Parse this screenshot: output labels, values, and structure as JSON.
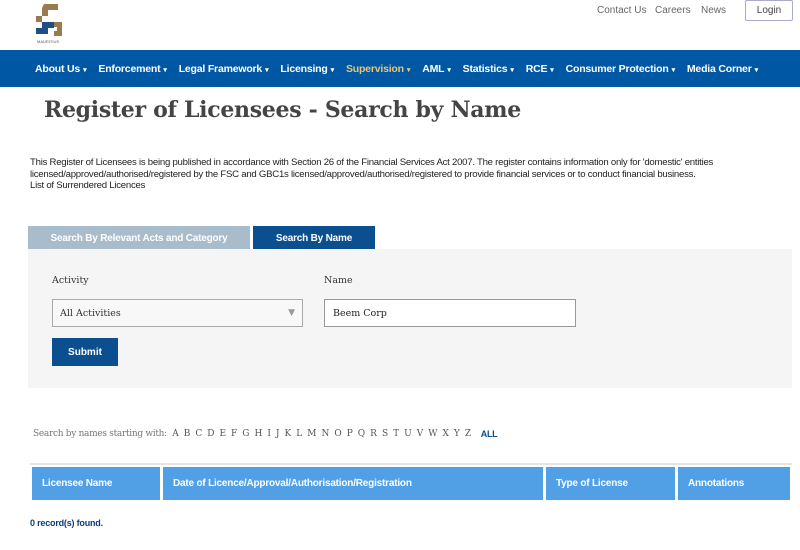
{
  "header": {
    "logo_text": "MAURITIUS",
    "links": [
      "Contact Us",
      "Careers",
      "News"
    ],
    "login_label": "Login"
  },
  "nav": {
    "items": [
      "About Us",
      "Enforcement",
      "Legal Framework",
      "Licensing",
      "Supervision",
      "AML",
      "Statistics",
      "RCE",
      "Consumer Protection",
      "Media Corner"
    ],
    "active": "Supervision",
    "caret": "▾"
  },
  "page": {
    "title": "Register of Licensees - Search by Name",
    "intro": "This Register of Licensees is being published in accordance with Section 26 of the Financial Services Act 2007. The register contains information only for 'domestic' entities licensed/approved/authorised/registered by the FSC and GBC1s licensed/approved/authorised/registered to provide financial services or to conduct financial business.",
    "surrendered_link": "List of Surrendered Licences"
  },
  "tabs": [
    {
      "label": "Search By Relevant Acts and Category",
      "active": false
    },
    {
      "label": "Search By Name",
      "active": true
    }
  ],
  "form": {
    "activity_label": "Activity",
    "activity_value": "All Activities",
    "name_label": "Name",
    "name_value": "Beem Corp",
    "submit_label": "Submit"
  },
  "alpha": {
    "label": "Search by names starting with:",
    "letters": [
      "A",
      "B",
      "C",
      "D",
      "E",
      "F",
      "G",
      "H",
      "I",
      "J",
      "K",
      "L",
      "M",
      "N",
      "O",
      "P",
      "Q",
      "R",
      "S",
      "T",
      "U",
      "V",
      "W",
      "X",
      "Y",
      "Z"
    ],
    "all_label": "ALL"
  },
  "table": {
    "columns": [
      "Licensee Name",
      "Date of Licence/Approval/Authorisation/Registration",
      "Type of License",
      "Annotations"
    ],
    "rows": []
  },
  "records_text": "0 record(s) found.",
  "colors": {
    "nav": "#0057a3",
    "accent": "#0b4f91",
    "table_header": "#51a0e6",
    "active_nav": "#e8c67a"
  }
}
